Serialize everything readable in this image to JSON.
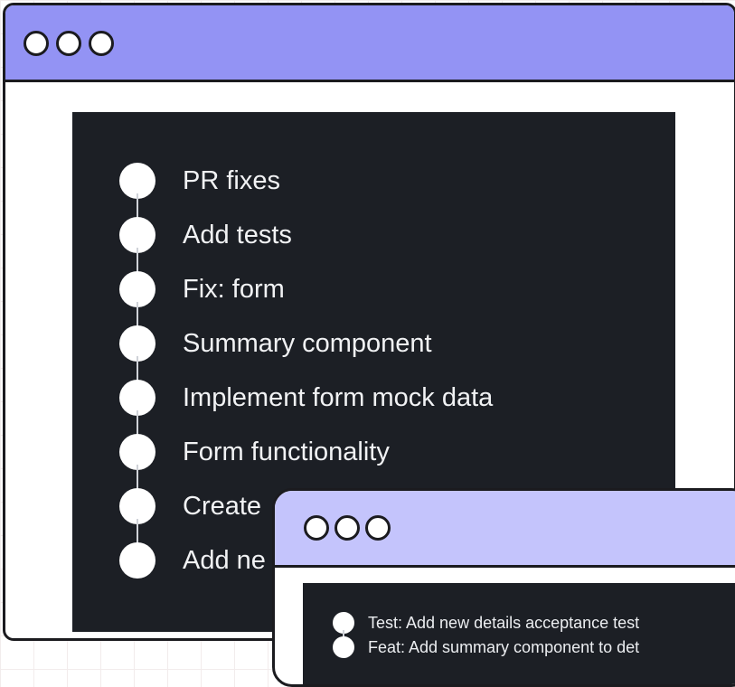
{
  "main_window": {
    "title_dots": [
      "window-dot",
      "window-dot",
      "window-dot"
    ],
    "commits": [
      {
        "message": "PR fixes"
      },
      {
        "message": "Add tests"
      },
      {
        "message": "Fix: form"
      },
      {
        "message": "Summary component"
      },
      {
        "message": "Implement form mock data"
      },
      {
        "message": "Form functionality"
      },
      {
        "message": "Create"
      },
      {
        "message": "Add ne"
      }
    ]
  },
  "overlay_window": {
    "title_dots": [
      "window-dot",
      "window-dot",
      "window-dot"
    ],
    "commits": [
      {
        "message": "Test: Add new details acceptance test"
      },
      {
        "message": "Feat: Add summary component to det"
      }
    ]
  },
  "colors": {
    "main_titlebar": "#9393f4",
    "overlay_titlebar": "#c4c4fc",
    "panel_background": "#1c1f25",
    "commit_node": "#ffffff",
    "border": "#1b1b1f"
  }
}
